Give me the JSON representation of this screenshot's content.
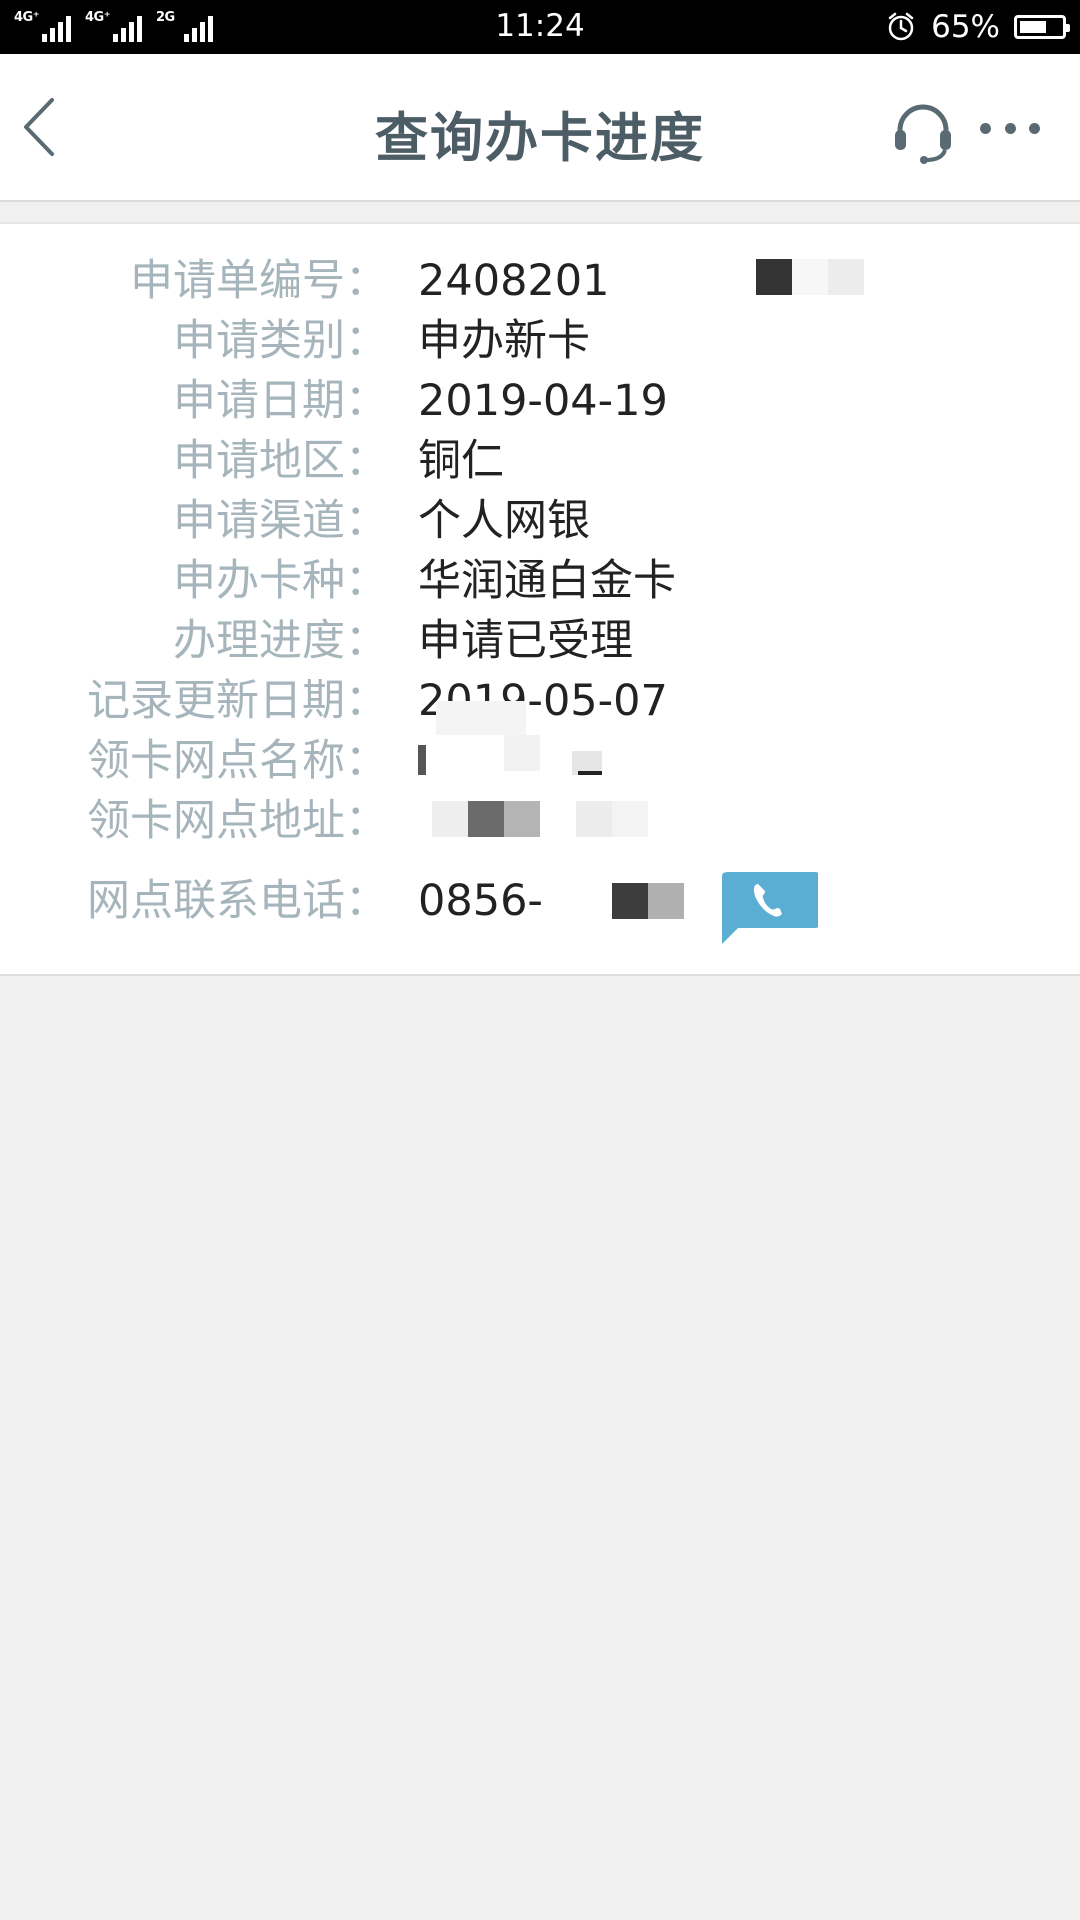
{
  "status_bar": {
    "network_1": "4G⁺",
    "network_2": "4G⁺",
    "network_3": "2G",
    "time": "11:24",
    "battery_percent_text": "65%",
    "battery_level": 0.65,
    "icons": [
      "signal-icon",
      "alarm-icon",
      "battery-icon"
    ]
  },
  "header": {
    "title": "查询办卡进度",
    "back_icon": "chevron-left-icon",
    "service_icon": "headset-icon",
    "more_icon": "more-dots-icon"
  },
  "details": {
    "rows": [
      {
        "label": "申请单编号：",
        "value": "24082019"
      },
      {
        "label": "申请类别：",
        "value": "申办新卡"
      },
      {
        "label": "申请日期：",
        "value": "2019-04-19"
      },
      {
        "label": "申请地区：",
        "value": "铜仁"
      },
      {
        "label": "申请渠道：",
        "value": "个人网银"
      },
      {
        "label": "申办卡种：",
        "value": "华润通白金卡"
      },
      {
        "label": "办理进度：",
        "value": "申请已受理"
      },
      {
        "label": "记录更新日期：",
        "value": "2019-05-07"
      },
      {
        "label": "领卡网点名称：",
        "value": ""
      },
      {
        "label": "领卡网点地址：",
        "value": ""
      },
      {
        "label": "网点联系电话：",
        "value": "0856-522"
      }
    ],
    "call_icon": "phone-icon"
  },
  "colors": {
    "title": "#4d5d66",
    "label": "#a6b4bb",
    "value": "#222222",
    "call_button": "#5aaed4",
    "background": "#f0f0f0"
  }
}
